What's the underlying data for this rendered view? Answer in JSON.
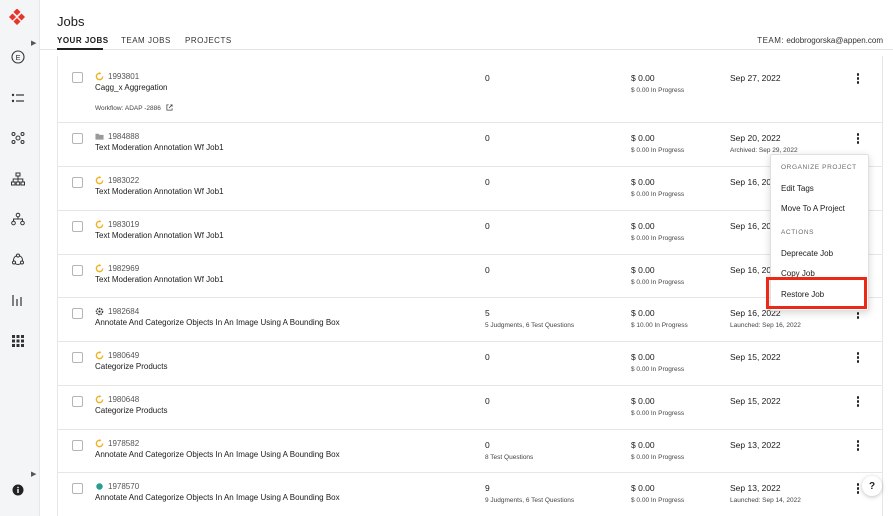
{
  "header": {
    "title": "Jobs",
    "tabs": [
      {
        "label": "YOUR JOBS",
        "active": true
      },
      {
        "label": "TEAM JOBS",
        "active": false
      },
      {
        "label": "PROJECTS",
        "active": false
      }
    ],
    "team_label": "TEAM:",
    "team_value": "edobrogorska@appen.com"
  },
  "sidebar": {
    "icons": [
      "appen-logo-icon",
      "e-circle-icon",
      "list-icon",
      "network-icon",
      "hierarchy-icon",
      "tree-icon",
      "cycle-icon",
      "bar-chart-icon",
      "grid-icon",
      "info-icon"
    ]
  },
  "jobs": [
    {
      "id": "1993801",
      "title": "Cagg_x Aggregation",
      "status_icon": "running-icon",
      "workflow": "Workflow: ADAP -2886",
      "judgments": "0",
      "judgments_sub": "",
      "cost": "$ 0.00",
      "cost_sub": "$ 0.00 In Progress",
      "date": "Sep 27, 2022",
      "date_sub": ""
    },
    {
      "id": "1984888",
      "title": "Text Moderation Annotation Wf Job1",
      "status_icon": "folder-icon",
      "judgments": "0",
      "judgments_sub": "",
      "cost": "$ 0.00",
      "cost_sub": "$ 0.00 In Progress",
      "date": "Sep 20, 2022",
      "date_sub": "Archived: Sep 29, 2022"
    },
    {
      "id": "1983022",
      "title": "Text Moderation Annotation Wf Job1",
      "status_icon": "running-icon",
      "judgments": "0",
      "judgments_sub": "",
      "cost": "$ 0.00",
      "cost_sub": "$ 0.00 In Progress",
      "date": "Sep 16, 2022",
      "date_sub": ""
    },
    {
      "id": "1983019",
      "title": "Text Moderation Annotation Wf Job1",
      "status_icon": "running-icon",
      "judgments": "0",
      "judgments_sub": "",
      "cost": "$ 0.00",
      "cost_sub": "$ 0.00 In Progress",
      "date": "Sep 16, 2022",
      "date_sub": ""
    },
    {
      "id": "1982969",
      "title": "Text Moderation Annotation Wf Job1",
      "status_icon": "running-icon",
      "judgments": "0",
      "judgments_sub": "",
      "cost": "$ 0.00",
      "cost_sub": "$ 0.00 In Progress",
      "date": "Sep 16, 2022",
      "date_sub": ""
    },
    {
      "id": "1982684",
      "title": "Annotate And Categorize Objects In An Image Using A Bounding Box",
      "status_icon": "gear-icon",
      "judgments": "5",
      "judgments_sub": "5 Judgments, 6 Test Questions",
      "cost": "$ 0.00",
      "cost_sub": "$ 10.00 In Progress",
      "date": "Sep 16, 2022",
      "date_sub": "Launched: Sep 16, 2022"
    },
    {
      "id": "1980649",
      "title": "Categorize Products",
      "status_icon": "running-icon",
      "judgments": "0",
      "judgments_sub": "",
      "cost": "$ 0.00",
      "cost_sub": "$ 0.00 In Progress",
      "date": "Sep 15, 2022",
      "date_sub": ""
    },
    {
      "id": "1980648",
      "title": "Categorize Products",
      "status_icon": "running-icon",
      "judgments": "0",
      "judgments_sub": "",
      "cost": "$ 0.00",
      "cost_sub": "$ 0.00 In Progress",
      "date": "Sep 15, 2022",
      "date_sub": ""
    },
    {
      "id": "1978582",
      "title": "Annotate And Categorize Objects In An Image Using A Bounding Box",
      "status_icon": "running-icon",
      "judgments": "0",
      "judgments_sub": "8 Test Questions",
      "cost": "$ 0.00",
      "cost_sub": "$ 0.00 In Progress",
      "date": "Sep 13, 2022",
      "date_sub": ""
    },
    {
      "id": "1978570",
      "title": "Annotate And Categorize Objects In An Image Using A Bounding Box",
      "status_icon": "dot-icon",
      "judgments": "9",
      "judgments_sub": "9 Judgments, 6 Test Questions",
      "cost": "$ 0.00",
      "cost_sub": "$ 0.00 In Progress",
      "date": "Sep 13, 2022",
      "date_sub": "Launched: Sep 14, 2022"
    }
  ],
  "menu": {
    "section1": "ORGANIZE PROJECT",
    "edit_tags": "Edit Tags",
    "move_to_project": "Move To A Project",
    "section2": "ACTIONS",
    "deprecate": "Deprecate Job",
    "copy": "Copy Job",
    "restore": "Restore Job"
  },
  "help_label": "?",
  "colors": {
    "accent_red": "#ea2a16",
    "running_yellow": "#f2b01e",
    "dot_teal": "#2a9d8f"
  }
}
